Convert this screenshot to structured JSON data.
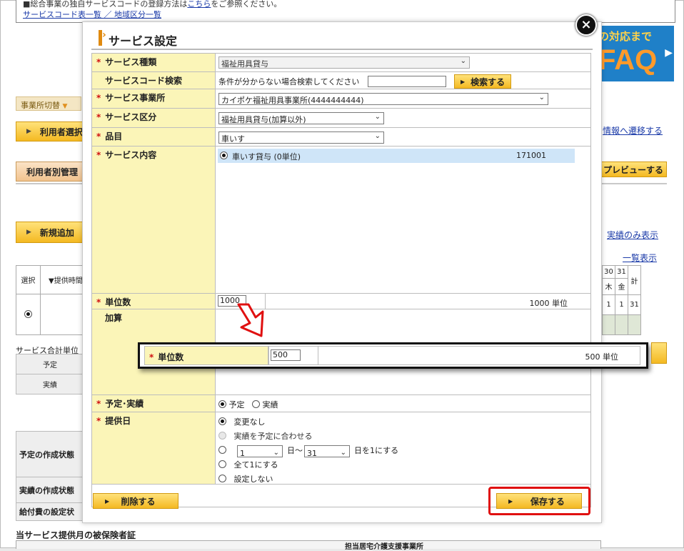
{
  "background": {
    "top_text": "■総合事業の独自サービスコードの登録方法は",
    "top_link_inline": "こちら",
    "top_text_tail": "をご参照ください。",
    "top_link_line2": "サービスコード表一覧 ／ 地域区分一覧",
    "tab_label": "事業所切替",
    "btn_user_select": "利用者選択",
    "btn_user_manage": "利用者別管理",
    "btn_new_add": "新規追加",
    "faq_line1": "の対応まで",
    "faq_line2": "FAQ",
    "link_transition": "情報へ遷移する",
    "btn_preview": "プレビューする",
    "link_actual_only": "実績のみ表示",
    "link_list": "一覧表示",
    "grid_headers": [
      "選択",
      "▼提供時間"
    ],
    "grid_day_nums": [
      "30",
      "31"
    ],
    "grid_weekdays": [
      "木",
      "金"
    ],
    "grid_total": "計",
    "grid_row_vals": [
      "1",
      "1",
      "31"
    ],
    "label_service_total": "サービス合計単位",
    "small_rows": [
      "予定",
      "実績"
    ],
    "status_rows": [
      "予定の作成状態",
      "実績の作成状態",
      "給付費の設定状"
    ],
    "footer_title": "当サービス提供月の被保険者証",
    "footer_partial": "担当居宅介護支援事業所"
  },
  "modal": {
    "title": "サービス設定",
    "close_label": "×",
    "rows": {
      "service_type": {
        "label": "サービス種類",
        "value": "福祉用具貸与"
      },
      "service_code_search": {
        "label": "サービスコード検索",
        "hint": "条件が分からない場合検索してください",
        "input_value": "",
        "button": "検索する"
      },
      "provider": {
        "label": "サービス事業所",
        "value": "カイポケ福祉用具事業所(4444444444)"
      },
      "service_class": {
        "label": "サービス区分",
        "value": "福祉用具貸与(加算以外)"
      },
      "item": {
        "label": "品目",
        "value": "車いす"
      },
      "service_content": {
        "label": "サービス内容",
        "option_label": "車いす貸与 (0単位)",
        "option_code": "171001"
      },
      "units": {
        "label": "単位数",
        "input_value": "1000",
        "units_text": "1000 単位"
      },
      "addition": {
        "label": "加算"
      },
      "plan_actual": {
        "label": "予定･実績",
        "opt_plan": "予定",
        "opt_actual": "実績"
      },
      "provide_date": {
        "label": "提供日",
        "opt_nochange": "変更なし",
        "opt_match": "実績を予定に合わせる",
        "day_from": "1",
        "day_sep": "日～",
        "day_to": "31",
        "day_suffix": "日を1にする",
        "opt_all_one": "全て1にする",
        "opt_none": "設定しない"
      }
    },
    "delete_button": "削除する",
    "save_button": "保存する"
  },
  "callout": {
    "label": "単位数",
    "input_value": "500",
    "units_text": "500 単位"
  },
  "colors": {
    "label_bg": "#fbf5b8",
    "required": "#d01010",
    "button_orange": "#f4b922",
    "highlight_red": "#e01010",
    "selected_row": "#cfe5f8"
  }
}
